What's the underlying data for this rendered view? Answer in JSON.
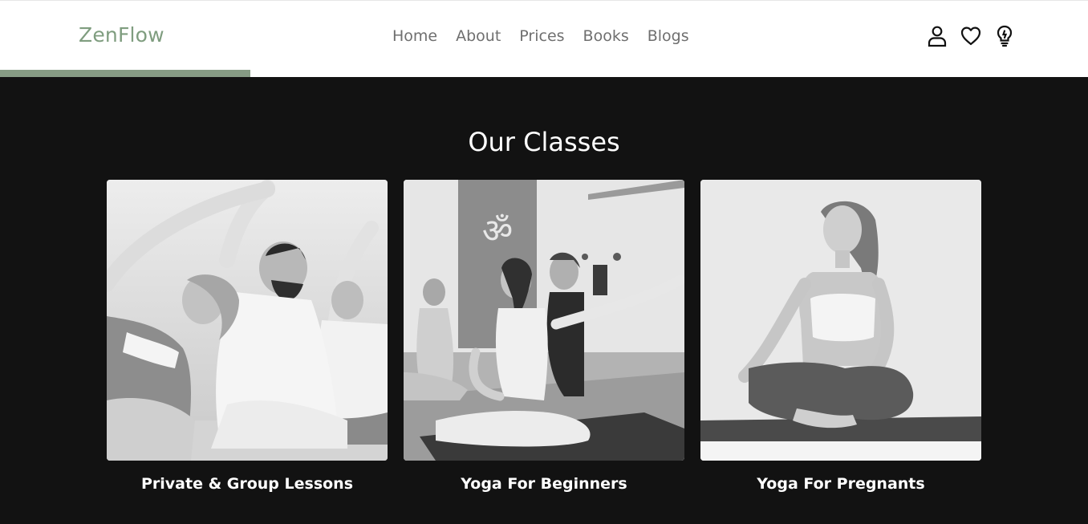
{
  "brand": {
    "name": "ZenFlow",
    "color": "#7f9d7f",
    "accent": "#869b84"
  },
  "nav": {
    "items": [
      {
        "label": "Home"
      },
      {
        "label": "About"
      },
      {
        "label": "Prices"
      },
      {
        "label": "Books"
      },
      {
        "label": "Blogs"
      }
    ]
  },
  "header_icons": [
    "user-icon",
    "heart-icon",
    "lightbulb-icon"
  ],
  "classes": {
    "title": "Our Classes",
    "items": [
      {
        "title": "Private & Group Lessons",
        "image": "group-yoga-side-stretch-photo"
      },
      {
        "title": "Yoga For Beginners",
        "image": "instructor-assisting-student-photo"
      },
      {
        "title": "Yoga For Pregnants",
        "image": "seated-meditation-photo"
      }
    ]
  }
}
